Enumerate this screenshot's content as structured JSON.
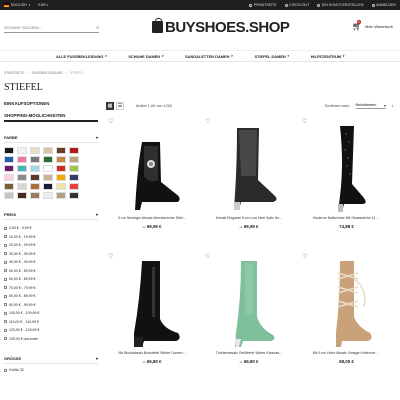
{
  "topbar": {
    "language": "ENGLISH",
    "currency": "EUR",
    "links": [
      "PRIVATSEITE",
      "CHECKOUT",
      "EIN KONTO ERSTELLEN",
      "ANMELDEN"
    ]
  },
  "header": {
    "search_placeholder": "SCHUHE SUCHEN...",
    "logo": "BUYSHOES.SHOP",
    "cart_label": "Mein Warenkorb",
    "cart_count": "0"
  },
  "nav": [
    "ALLE FUSSBEKLEIDUNG",
    "SCHUHE DAMEN",
    "SANDALETTEN DAMEN",
    "STIEFEL DAMEN",
    "HILFEZENTRUM"
  ],
  "breadcrumb": [
    "STARTSEITE",
    "FUSSBEKLEIDUNG",
    "STIEFEL"
  ],
  "page_title": "STIEFEL",
  "sidebar": {
    "options_title": "EINKAUFSOPTIONEN",
    "shop_title": "SHOPPING-MÖGLICHKEITEN",
    "color_title": "FARBE",
    "colors": [
      "#1a1a1a",
      "#f4f4f4",
      "#e8dcc7",
      "#d8c3a4",
      "#6b3e26",
      "#b21a1a",
      "#1f5ea8",
      "#e77aa6",
      "#777777",
      "#2d6a36",
      "#c38a45",
      "#bda37a",
      "#6a1b6a",
      "#45b3b7",
      "#9fdbe8",
      "#ffffff",
      "#d02b2b",
      "#a3c44c",
      "#fad1df",
      "#8a8a8a",
      "#5a3a22",
      "#c9b29a",
      "#f2a900",
      "#3a3a6a",
      "#7b5b3a",
      "#d6d6d6",
      "#aa6a3a",
      "#1d1d3a",
      "#f0e2a8",
      "#e2403c",
      "#c4c4c4",
      "#4a2a1a",
      "#9a7a5a",
      "#eeeeee",
      "#b0a080",
      "#333333"
    ],
    "price_title": "PREIS",
    "prices": [
      "0,00 € - 9,99 €",
      "10,00 € - 19,99 €",
      "20,00 € - 29,99 €",
      "30,00 € - 39,99 €",
      "40,00 € - 49,99 €",
      "50,00 € - 59,99 €",
      "60,00 € - 69,99 €",
      "70,00 € - 79,99 €",
      "80,00 € - 89,99 €",
      "90,00 € - 99,99 €",
      "100,00 € - 109,99 €",
      "110,00 € - 119,99 €",
      "120,00 € - 129,99 €",
      "130,00 € und mehr"
    ],
    "size_title": "GRÖSSE",
    "sizes": [
      "Größe 32"
    ]
  },
  "toolbar": {
    "count_text": "Artikel 1-60 von 1263",
    "sort_label": "Sortieren nach",
    "sort_value": "Beliebtesten"
  },
  "products": [
    {
      "name": "5 cm Niedriger Absatz Abendschuhe Stief...",
      "prefix": "ab",
      "price": "69,99 €",
      "art": "ankle-buckle"
    },
    {
      "name": "Kristall Elegante 5 cm Low Heel Spitz No...",
      "prefix": "ab",
      "price": "69,99 €",
      "art": "mesh-sock"
    },
    {
      "name": "Moderne Ballschuhe Mit Strasssteine 11 ...",
      "prefix": "",
      "price": "74,88 €",
      "art": "thigh-high"
    },
    {
      "name": "Mit Blockabsatz Bolrstiefel Winter Damen...",
      "prefix": "ab",
      "price": "65,80 €",
      "art": "knee-black"
    },
    {
      "name": "Trichterabsatz Gefütterte Winter Klassiss...",
      "prefix": "ab",
      "price": "69,80 €",
      "art": "knee-green"
    },
    {
      "name": "Mit 9 cm Hohe Absatz Vintage Kniehohe ...",
      "prefix": "",
      "price": "68,00 €",
      "art": "lace-tan"
    }
  ]
}
